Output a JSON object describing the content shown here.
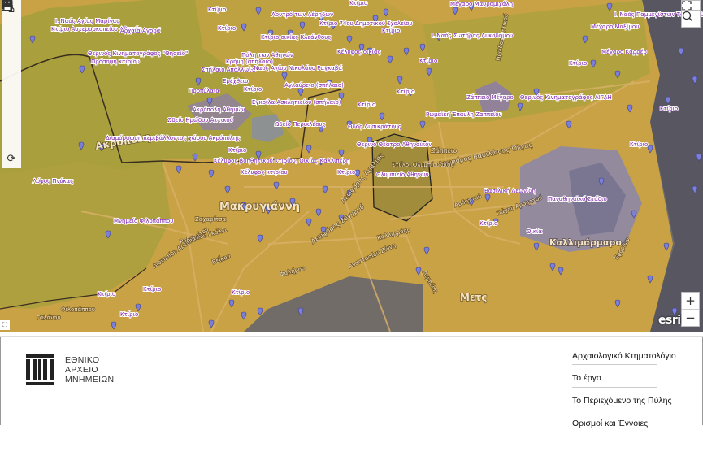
{
  "map": {
    "colors": {
      "zone": "#c9a245",
      "hill": "#a3a03c",
      "dark": "#6f6b70",
      "purple": "#8a7ab0",
      "label": "#7a1fa6",
      "white_label": "#ffffff",
      "marker": "#7b7fd8"
    },
    "labels_purple": [
      "Ι. Ναός Αγίας Μαρίνας",
      "Κτίριο Αστεροσκοπείου Αθηνών",
      "Αρχαία Αγορά",
      "Θερινός Κινηματογράφος \"Θησείο\"",
      "Πρόσοψη κτιρίου",
      "Κρήνη (σπήλαιο)",
      "Σπήλαιο Απόλλωνα",
      "Ερέχθειο",
      "Προπύλαια",
      "Ακρόπολη Αθηνών",
      "Ωδείο Ηρώδου Αττικού",
      "Διαμόρφωση περιβάλλοντος χώρου Ακρόπολης",
      "Λόφος Πνύκας",
      "Μνημείο Φιλοπάππου",
      "Πόλη των Αθηνών",
      "Ι. Ναός Αγίου Νικολάου Ραγκαβά",
      "Αγλαύρειο (σπήλαιο)",
      "Εγκοίλα Ασκληπιείου (σπήλαιο)",
      "Ωδείο Περικλέους",
      "Κέλυφος βοηθητικού κτιρίου, Οικίας Καλλιπέρη",
      "Κέλυφος κτιρίου",
      "Ολυμπιείο Αθηνών",
      "Θερινό Θέατρο Αθηναϊκόν",
      "Ζάππειο Μέγαρο",
      "Ρωμαϊκή Έπαυλη Ζαππείου",
      "Θερινός Κινηματογράφος ΑΙΓΛΗ",
      "Βασιλική Λεωνίδη",
      "Παναθηναϊκό Στάδιο",
      "Οικία",
      "Κτίριο",
      "Μέγαρο Μαυρομιχάλη",
      "Ι. Ναός Σωτήρας Λυκοδήμου",
      "Ι. Ναός Παμμεγίστων Ταξιαρχών",
      "Μέγαρο Μαξίμου",
      "Μέγαρο Καρρέρ",
      "Κτίριο 74ου Δημοτικού Σχολείου",
      "Λουτρό των Αέρηδων",
      "Κτίριο οικίας Κλεάνθους",
      "Οδός Λυσικράτους",
      "Κέλυφος οικίας"
    ],
    "labels_street": [
      "Ακρόπολη",
      "Μακρυγιάννη",
      "Καλλιμάρμαρο",
      "Μετς",
      "Λεωφόρος Βασιλίσσης Όλγας",
      "Λεωφόρος Συγγρού",
      "Λεωφόρος Αμαλίας",
      "Ζάππειο",
      "Στύλοι Ολυμπίου Διός",
      "Βεΐκου",
      "Φαλήρου",
      "Ζαχαρίτσα",
      "Ροβέρτου Γκάλλι",
      "Διονυσίου Αρεοπαγίτου",
      "Αρδηττού",
      "Αναστασίου Ζίννη",
      "Φιλοπάππου",
      "Γαλάνου",
      "Λεμπέση",
      "Καλλιρρόης",
      "Ηρώδου Αττικού",
      "Πάγου Αρδηττού",
      "Εφορίων"
    ],
    "attribution": "esri",
    "zoom_in": "+",
    "zoom_out": "−",
    "tools": [
      "home-icon",
      "locate-icon",
      "grid-icon",
      "layers-icon",
      "list-icon",
      "ruler-icon",
      "map-pin-icon",
      "print-icon",
      "refresh-icon"
    ]
  },
  "footer": {
    "logo_lines": [
      "ΕΘΝΙΚΟ",
      "ΑΡΧΕΙΟ",
      "ΜΝΗΜΕΙΩΝ"
    ],
    "nav": {
      "heading": "Αρχαιολογικό Κτηματολόγιο",
      "items": [
        "Το έργο",
        "Το Περιεχόμενο της Πύλης",
        "Ορισμοί και Έννοιες"
      ]
    }
  }
}
